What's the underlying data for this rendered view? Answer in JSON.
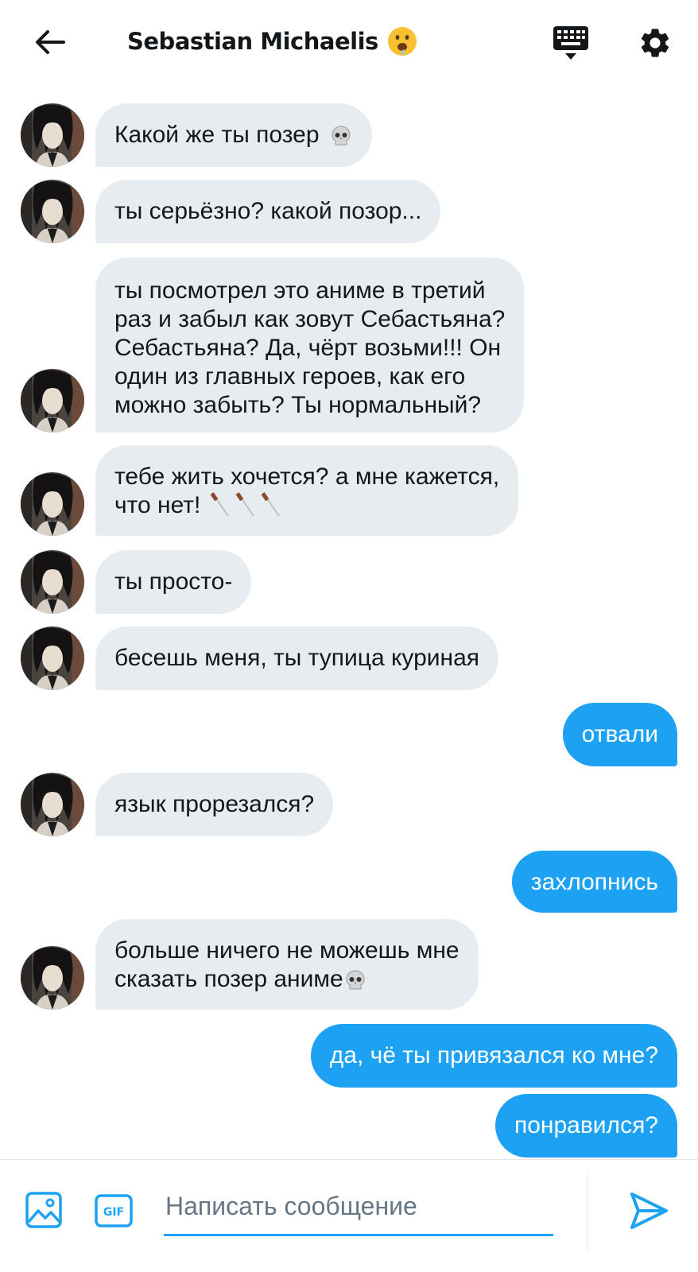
{
  "header": {
    "title": "Sebastian Michaelis",
    "title_emoji": "drooling-face-emoji",
    "back_icon": "arrow-left-icon",
    "keyboard_icon": "keyboard-icon",
    "settings_icon": "gear-icon"
  },
  "messages": [
    {
      "side": "in",
      "text": "Какой же ты позер",
      "emoji": "skull-emoji"
    },
    {
      "side": "in",
      "text": "ты серьёзно? какой позор..."
    },
    {
      "side": "in",
      "lines": [
        "ты посмотрел это аниме в третий",
        "раз и забыл как зовут Себастьяна?",
        "Себастьяна? Да, чёрт возьми!!! Он",
        "один из главных героев, как его",
        "можно забыть? Ты нормальный?"
      ]
    },
    {
      "side": "in",
      "lines": [
        "тебе жить хочется? а мне кажется,",
        "что нет!"
      ],
      "emoji": "knife-emoji-x3"
    },
    {
      "side": "in",
      "text": "ты просто-"
    },
    {
      "side": "in",
      "text": "бесешь меня, ты тупица куриная"
    },
    {
      "side": "out",
      "text": "отвали"
    },
    {
      "side": "in",
      "text": "язык прорезался?"
    },
    {
      "side": "out",
      "text": "захлопнись"
    },
    {
      "side": "in",
      "lines": [
        "больше ничего не можешь мне",
        "сказать позер аниме"
      ],
      "emoji": "skull-emoji"
    },
    {
      "side": "out",
      "text": "да, чё ты привязался ко мне?"
    },
    {
      "side": "out",
      "text": "понравился?"
    }
  ],
  "composer": {
    "placeholder": "Написать сообщение",
    "gif_label": "GIF",
    "image_icon": "image-icon",
    "send_icon": "send-icon"
  },
  "colors": {
    "accent": "#1da1f2",
    "incoming_bubble": "#e6ecf0",
    "text": "#14171a",
    "placeholder": "#657786"
  }
}
